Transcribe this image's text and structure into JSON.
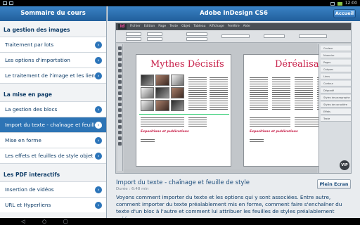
{
  "status_bar": {
    "time": "12:00"
  },
  "left_panel": {
    "title": "Sommaire du cours",
    "sections": [
      {
        "title": "La gestion des images",
        "items": [
          {
            "label": "Traitement par lots",
            "active": false
          },
          {
            "label": "Les options d'importation",
            "active": false
          },
          {
            "label": "Le traitement de l'image et les liens",
            "active": false
          }
        ]
      },
      {
        "title": "La mise en page",
        "items": [
          {
            "label": "La gestion des blocs",
            "active": false
          },
          {
            "label": "Import du texte - chaînage et feuille...",
            "active": true
          },
          {
            "label": "Mise en forme",
            "active": false
          },
          {
            "label": "Les effets et feuilles de style objet",
            "active": false
          }
        ]
      },
      {
        "title": "Les PDF interactifs",
        "items": [
          {
            "label": "Insertion de vidéos",
            "active": false
          },
          {
            "label": "URL et Hyperliens",
            "active": false
          }
        ]
      }
    ]
  },
  "right_panel": {
    "title": "Adobe InDesign CS6",
    "home_label": "Accueil",
    "video": {
      "menu_items": [
        "Fichier",
        "Edition",
        "Page",
        "Texte",
        "Objet",
        "Tableau",
        "Affichage",
        "Fenêtre",
        "Aide"
      ],
      "page_left_title": "Mythes Décisifs",
      "page_right_title": "Déréalisation",
      "caption": "Expositions et publications",
      "panel_items": [
        "Couleur",
        "Nuancier",
        "Pages",
        "Calques",
        "Liens",
        "Contour",
        "Dégradé",
        "Styles de paragraphe",
        "Styles de caractère",
        "Effets",
        "Texte"
      ]
    },
    "lesson": {
      "title": "Import du texte - chaînage et feuille de style",
      "duration": "Durée : 6:48 min",
      "fullscreen_label": "Plein Ecran",
      "description": "Voyons comment importer du texte et les options qui y sont associées. Entre autre, comment importer du texte préalablement mis en forme, comment faire s'enchaîner du texte d'un bloc à l'autre et comment lui attribuer les feuilles de styles préalablement créées."
    }
  },
  "colors": {
    "header_blue": "#2d74b5",
    "text_blue": "#0d3b66",
    "accent_red": "#c8224b"
  }
}
